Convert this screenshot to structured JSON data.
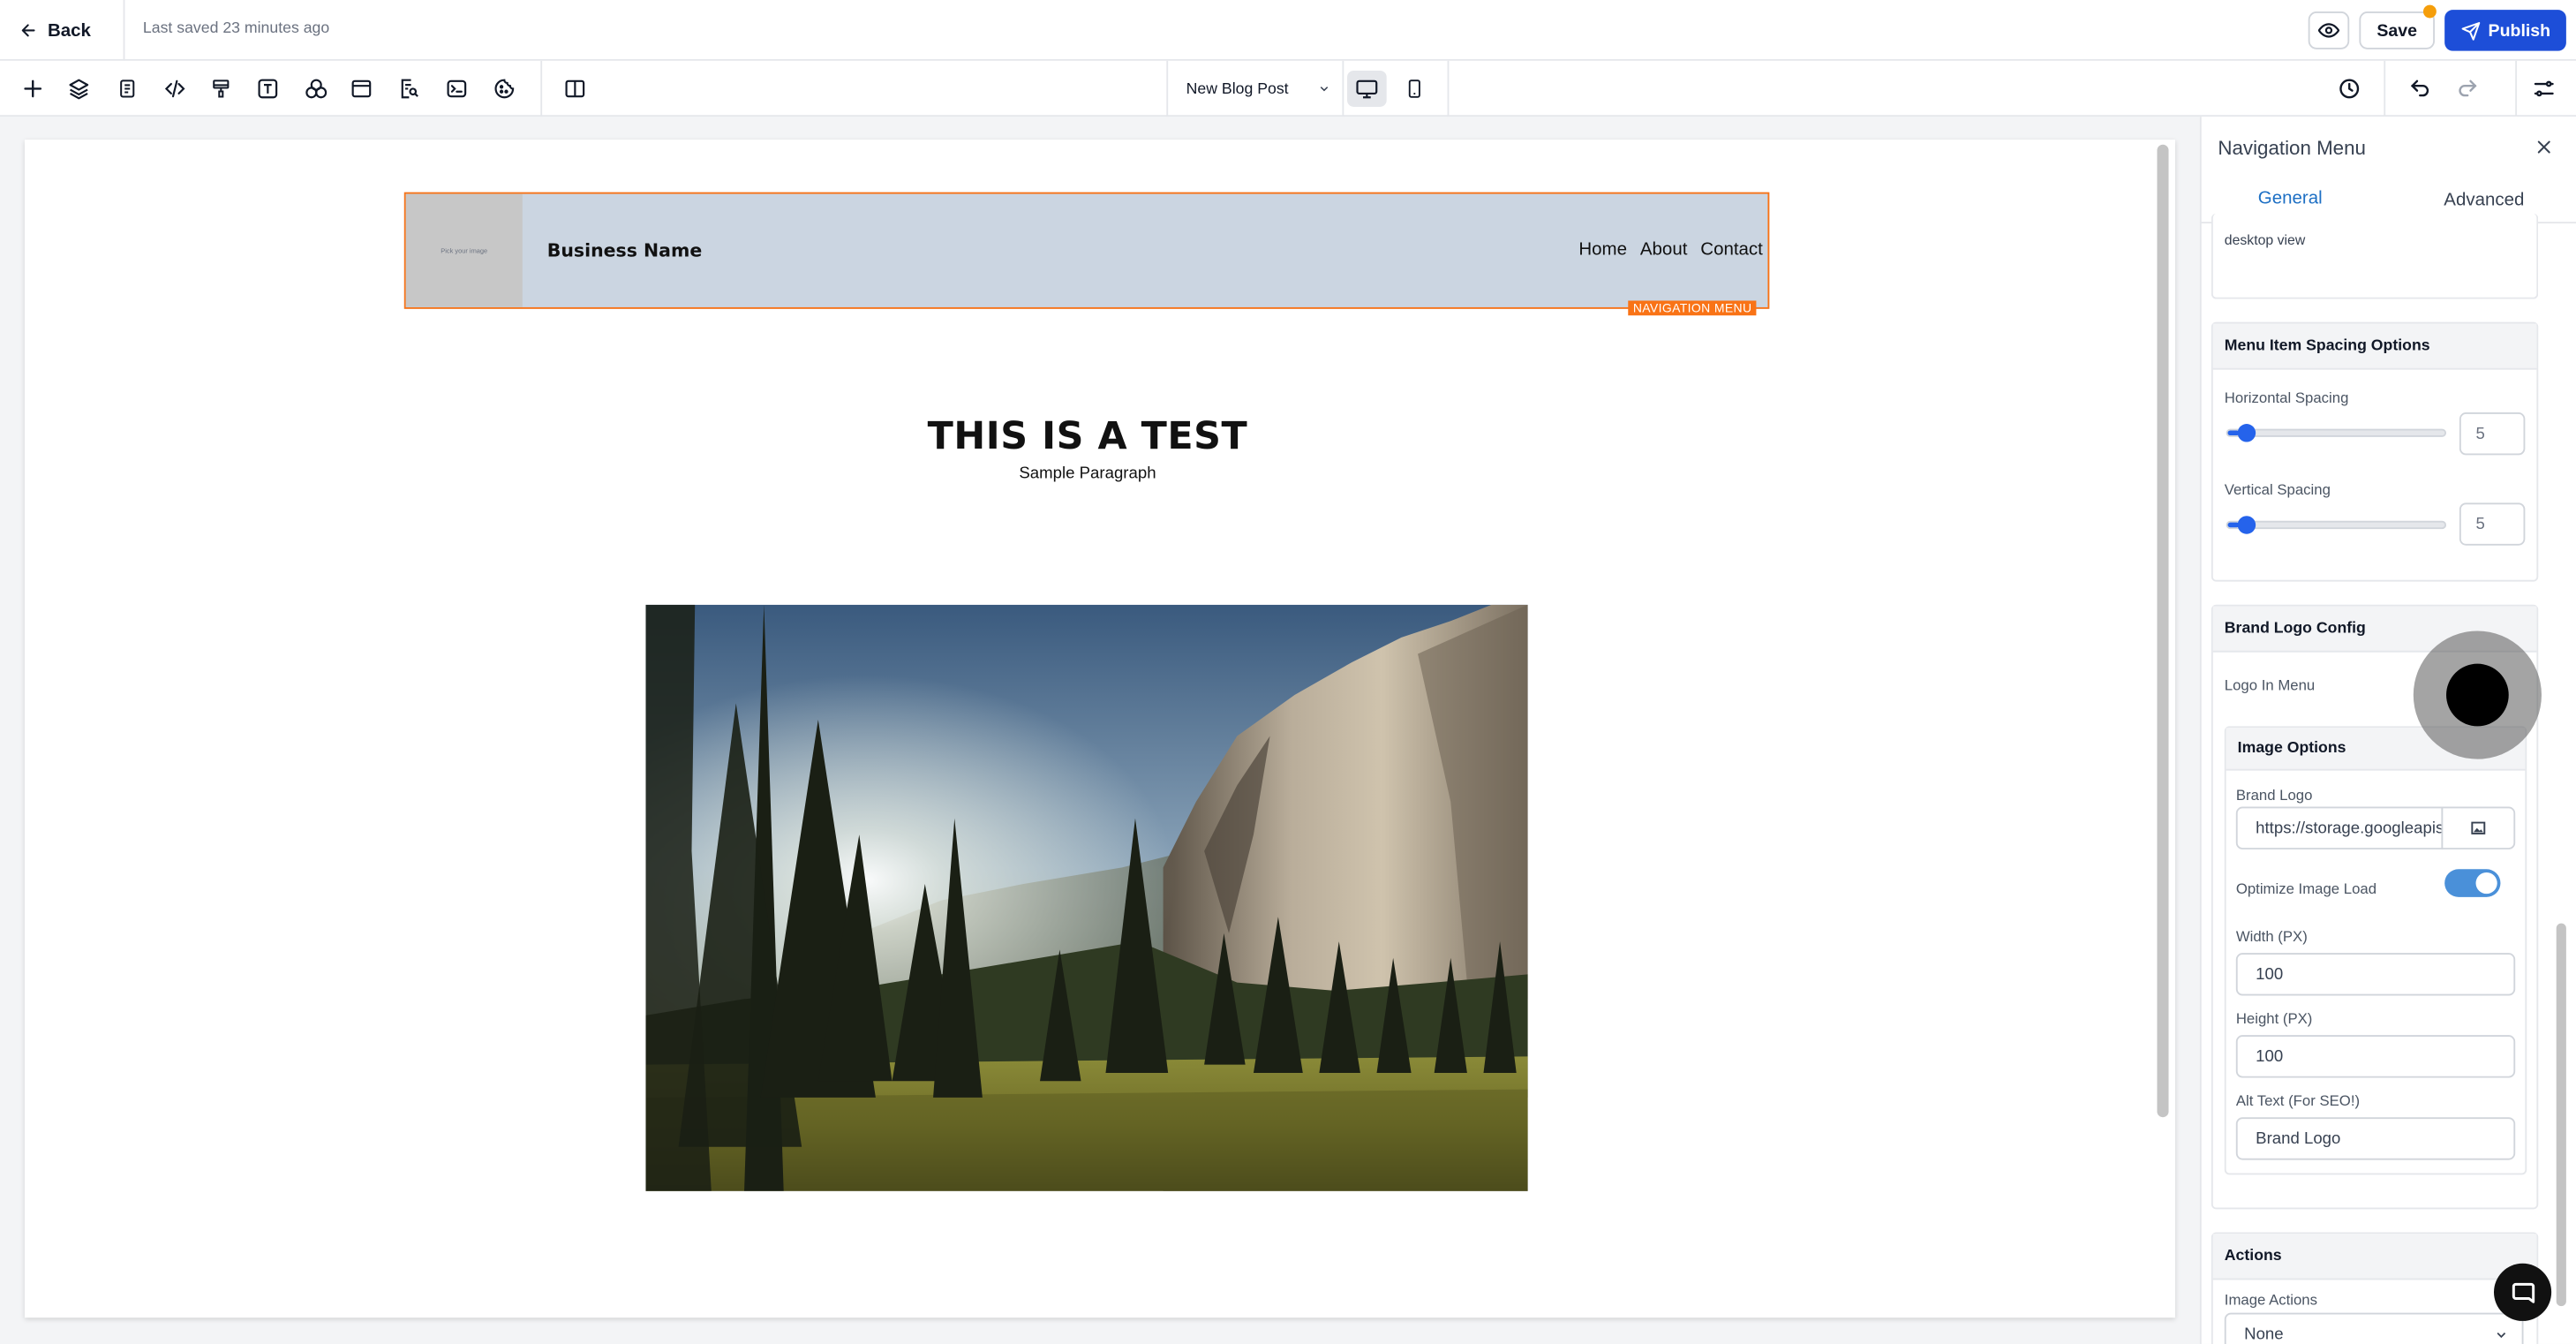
{
  "topbar": {
    "back_label": "Back",
    "last_saved": "Last saved 23 minutes ago",
    "save_label": "Save",
    "publish_label": "Publish"
  },
  "toolbar": {
    "tools": [
      "add-icon",
      "layers-icon",
      "pages-icon",
      "code-icon",
      "paint-icon",
      "text-icon",
      "components-icon",
      "section-icon",
      "seo-icon",
      "terminal-icon",
      "cookie-icon",
      "columns-icon"
    ],
    "page_select": "New Blog Post",
    "devices": [
      "desktop-icon",
      "mobile-icon"
    ]
  },
  "canvas": {
    "nav": {
      "logo_placeholder": "Pick your image",
      "business_name": "Business Name",
      "links": [
        "Home",
        "About",
        "Contact"
      ],
      "tag": "NAVIGATION MENU"
    },
    "hero_title": "THIS IS A TEST",
    "hero_paragraph": "Sample Paragraph"
  },
  "panel": {
    "title": "Navigation Menu",
    "tabs": [
      "General",
      "Advanced"
    ],
    "active_tab": "General",
    "top_card_text": "desktop view",
    "spacing": {
      "title": "Menu Item Spacing Options",
      "horizontal_label": "Horizontal Spacing",
      "horizontal_value": "5",
      "horizontal_fraction": 0.05,
      "vertical_label": "Vertical Spacing",
      "vertical_value": "5",
      "vertical_fraction": 0.05
    },
    "brand": {
      "title": "Brand Logo Config",
      "logo_in_menu_label": "Logo In Menu",
      "image_options_title": "Image Options",
      "brand_logo_label": "Brand Logo",
      "brand_logo_value": "https://storage.googleapis.com",
      "optimize_label": "Optimize Image Load",
      "optimize_on": true,
      "width_label": "Width (PX)",
      "width_value": "100",
      "height_label": "Height (PX)",
      "height_value": "100",
      "alt_label": "Alt Text (For SEO!)",
      "alt_value": "Brand Logo"
    },
    "actions": {
      "title": "Actions",
      "image_actions_label": "Image Actions",
      "image_actions_value": "None"
    }
  },
  "colors": {
    "accent": "#1d4ed8",
    "selection": "#f97316",
    "toggle_on": "#4a90d9"
  }
}
